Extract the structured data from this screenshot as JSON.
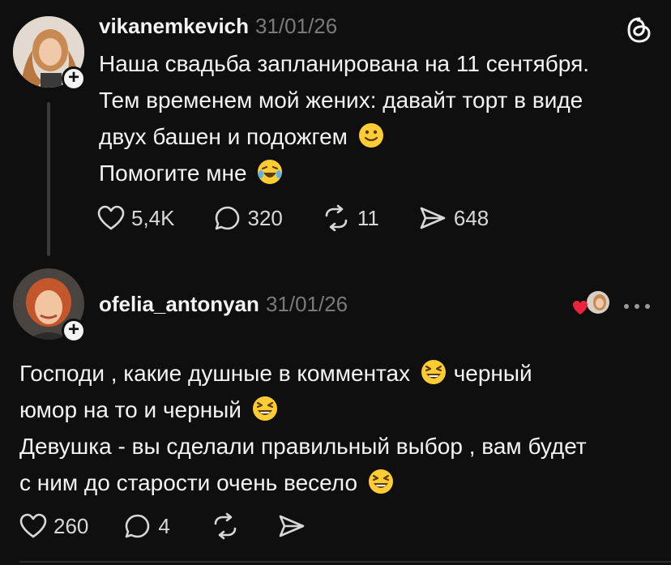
{
  "post": {
    "username": "vikanemkevich",
    "date": "31/01/26",
    "lines": [
      "Наша свадьба запланирована на 11 сентября.",
      "Тем временем мой жених: давайт торт в виде",
      "двух башен и подожгем",
      "Помогите мне"
    ],
    "stats": {
      "likes": "5,4K",
      "replies": "320",
      "reposts": "11",
      "shares": "648"
    }
  },
  "comment": {
    "username": "ofelia_antonyan",
    "date": "31/01/26",
    "lines": [
      "Господи , какие душные в комментах",
      "черный",
      "юмор на то и черный",
      "Девушка - вы сделали правильный выбор , вам будет",
      "с ним до старости очень весело"
    ],
    "stats": {
      "likes": "260",
      "replies": "4"
    }
  },
  "icons": {
    "app": "threads-icon",
    "like": "heart-icon",
    "reply": "comment-icon",
    "repost": "repost-icon",
    "share": "send-icon",
    "more": "more-icon",
    "slight_smile": "slightly-smiling-face-emoji",
    "laugh": "tears-of-joy-emoji",
    "grin": "grinning-squinting-face-emoji"
  },
  "colors": {
    "background": "#0f0f0f",
    "text": "#f3f3f3",
    "muted": "#7a7a7a",
    "heart": "#e8253a"
  }
}
